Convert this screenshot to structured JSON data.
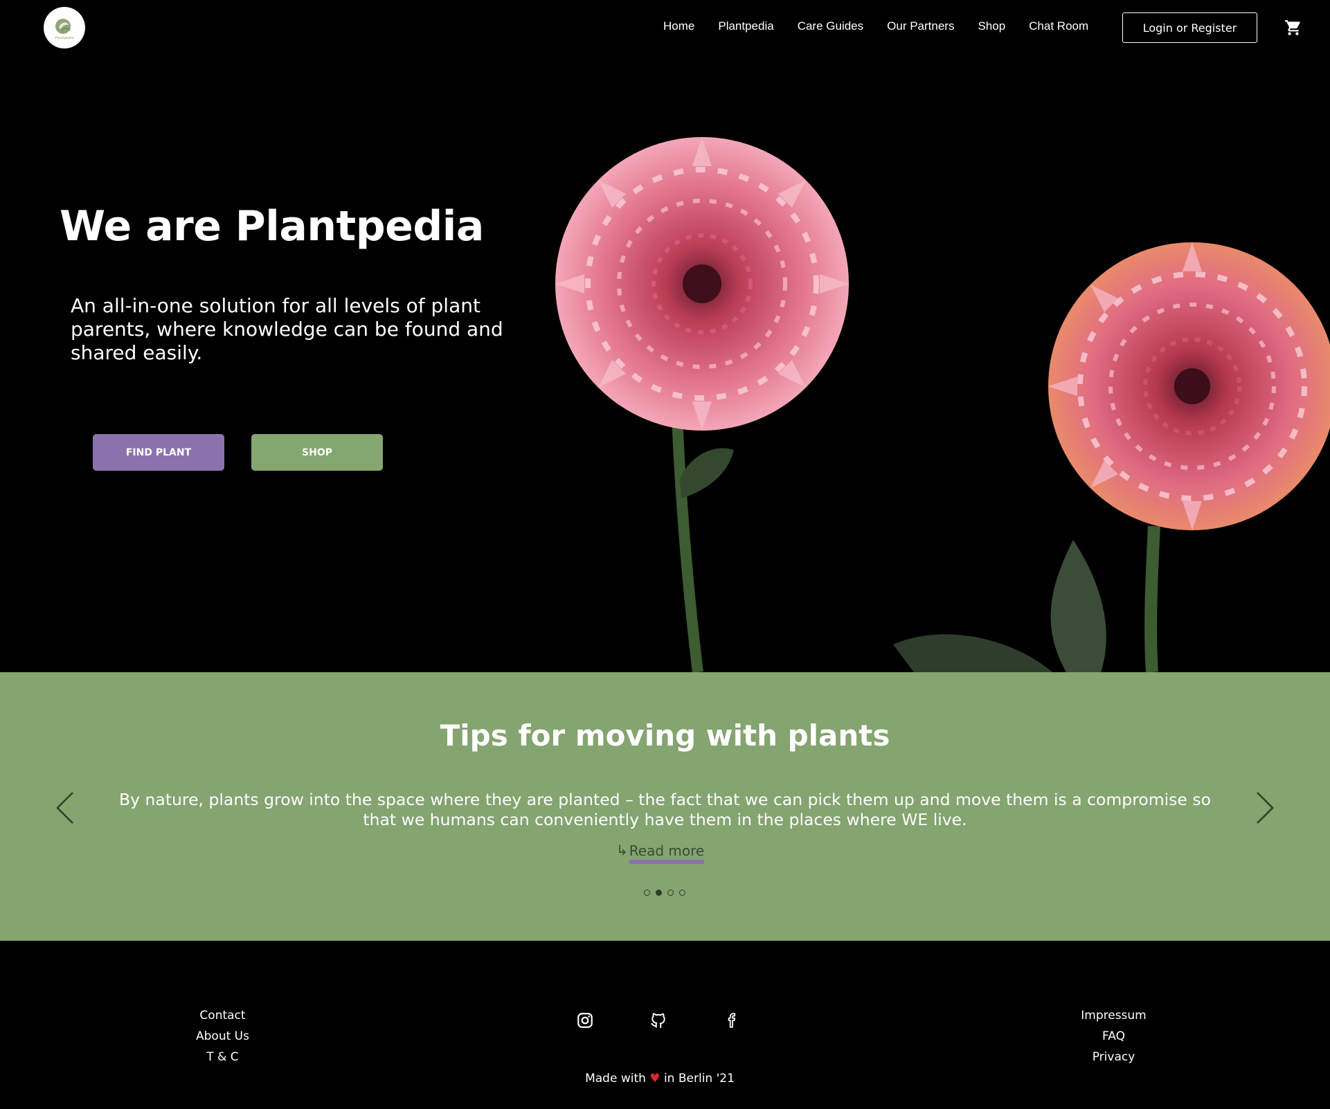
{
  "nav": {
    "links": [
      "Home",
      "Plantpedia",
      "Care Guides",
      "Our Partners",
      "Shop",
      "Chat Room"
    ],
    "login_label": "Login or Register",
    "cart_icon": "cart-icon",
    "logo_icon": "plantpedia-logo"
  },
  "hero": {
    "title": "We are Plantpedia",
    "subtitle": "An all-in-one solution for all levels of plant parents, where knowledge can be found and shared easily.",
    "find_plant_label": "FIND PLANT",
    "shop_label": "SHOP"
  },
  "tips": {
    "title": "Tips for moving with plants",
    "text": "By nature, plants grow into the space where they are planted – the fact that we can pick them up and move them is a compromise so that we humans can conveniently have them in the places where WE live.",
    "read_more_arrow": "↳",
    "read_more_label": "Read more",
    "active_slide": 2,
    "slide_count": 4
  },
  "footer": {
    "left_links": [
      "Contact",
      "About Us",
      "T & C"
    ],
    "right_links": [
      "Impressum",
      "FAQ",
      "Privacy"
    ],
    "social_icons": [
      "instagram-icon",
      "github-icon",
      "facebook-icon"
    ],
    "made_with_prefix": "Made with",
    "heart": "♥",
    "made_with_suffix": "in Berlin '21"
  },
  "colors": {
    "background": "#000000",
    "find_plant": "#8c72ad",
    "shop": "#84a671",
    "tips_band": "#84a470",
    "heart": "#e2262a"
  }
}
